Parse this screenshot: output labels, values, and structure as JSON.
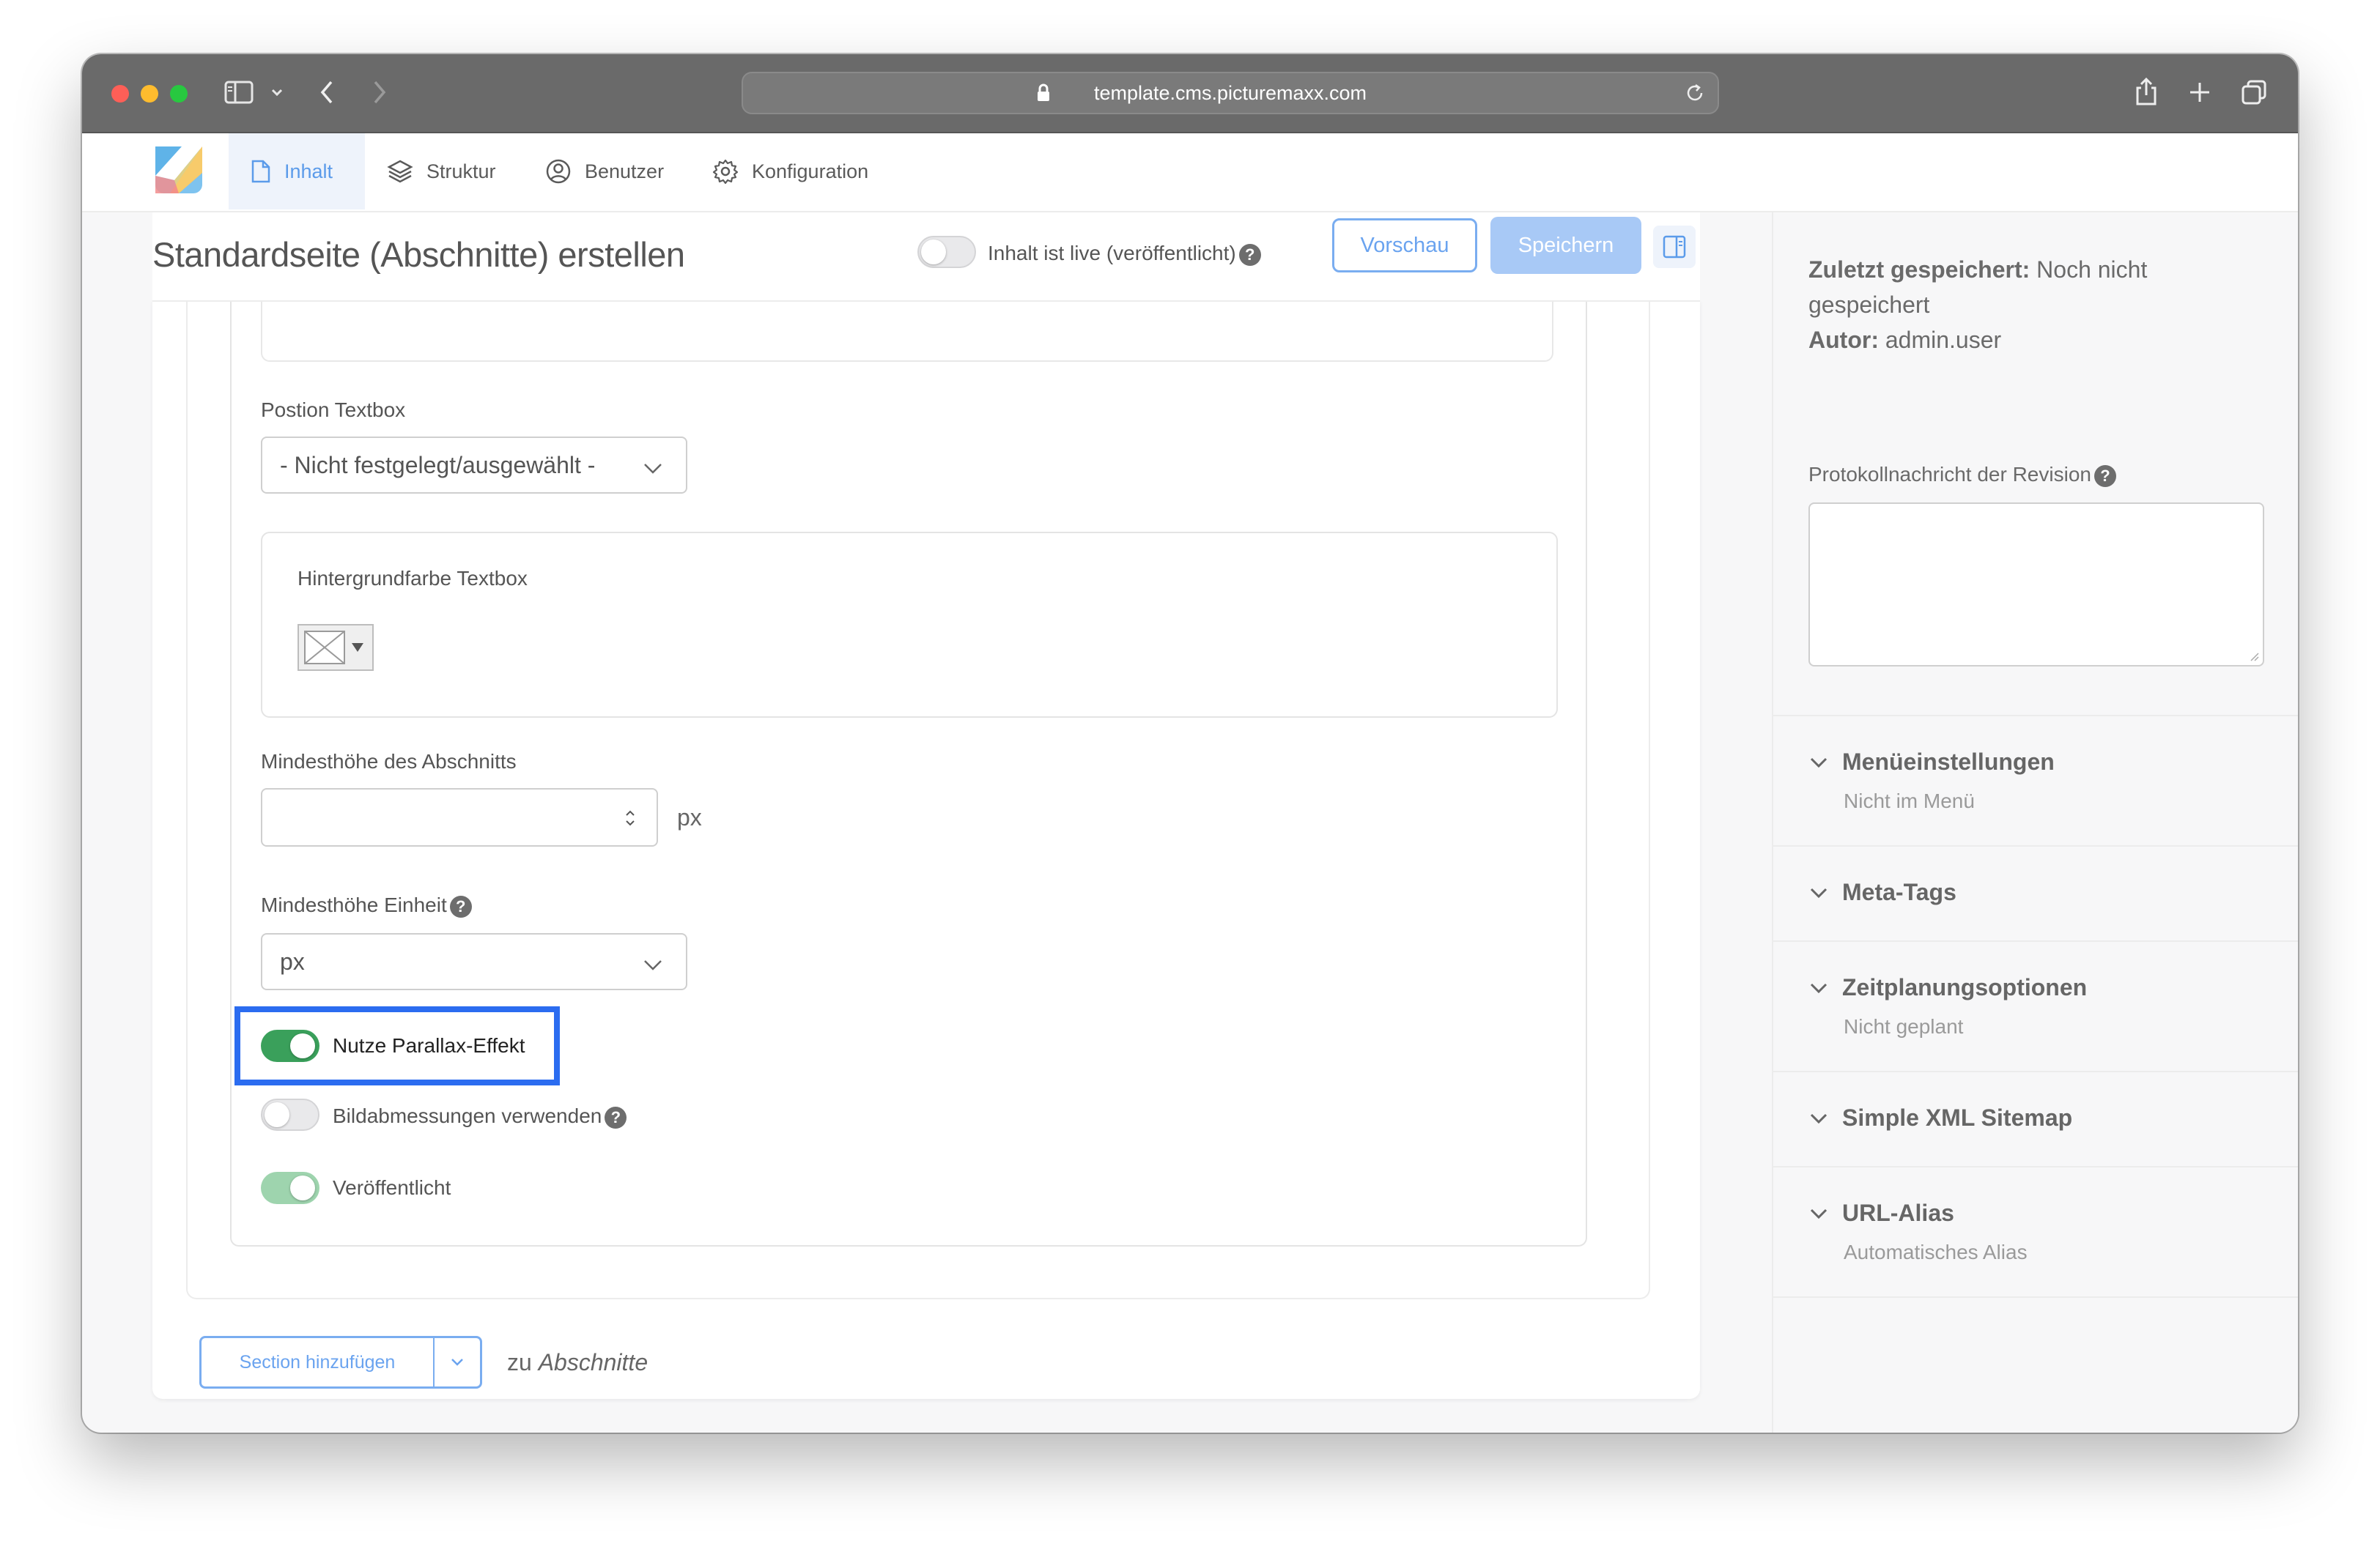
{
  "browser": {
    "url": "template.cms.picturemaxx.com"
  },
  "nav": {
    "tabs": [
      {
        "label": "Inhalt",
        "icon": "document-icon",
        "active": true
      },
      {
        "label": "Struktur",
        "icon": "layers-icon",
        "active": false
      },
      {
        "label": "Benutzer",
        "icon": "user-circle-icon",
        "active": false
      },
      {
        "label": "Konfiguration",
        "icon": "gear-icon",
        "active": false
      }
    ]
  },
  "header": {
    "title": "Standardseite (Abschnitte) erstellen",
    "live_label": "Inhalt ist live (veröffentlicht)",
    "live_enabled": false,
    "preview_label": "Vorschau",
    "save_label": "Speichern"
  },
  "form": {
    "position_label": "Postion Textbox",
    "position_value": "- Nicht festgelegt/ausgewählt -",
    "bgcolor_label": "Hintergrundfarbe Textbox",
    "minheight_label": "Mindesthöhe des Abschnitts",
    "minheight_value": "",
    "minheight_suffix": "px",
    "unit_label": "Mindesthöhe Einheit",
    "unit_value": "px",
    "parallax_label": "Nutze Parallax-Effekt",
    "parallax_on": true,
    "dims_label": "Bildabmessungen verwenden",
    "dims_on": false,
    "published_label": "Veröffentlicht",
    "published_on": true,
    "add_section_label": "Section hinzufügen",
    "add_to_prefix": "zu",
    "add_to_target": "Abschnitte"
  },
  "sidebar": {
    "saved_label": "Zuletzt gespeichert:",
    "saved_value_line1": "Noch nicht",
    "saved_value_line2": "gespeichert",
    "author_label": "Autor:",
    "author_value": "admin.user",
    "revision_label": "Protokollnachricht der Revision",
    "revision_value": "",
    "accordions": [
      {
        "title": "Menüeinstellungen",
        "summary": "Nicht im Menü"
      },
      {
        "title": "Meta-Tags",
        "summary": ""
      },
      {
        "title": "Zeitplanungsoptionen",
        "summary": "Nicht geplant"
      },
      {
        "title": "Simple XML Sitemap",
        "summary": ""
      },
      {
        "title": "URL-Alias",
        "summary": "Automatisches Alias"
      }
    ]
  },
  "colors": {
    "accent": "#5b9bea",
    "toggle_on": "#3aa05b",
    "highlight": "#2b6cf0"
  }
}
